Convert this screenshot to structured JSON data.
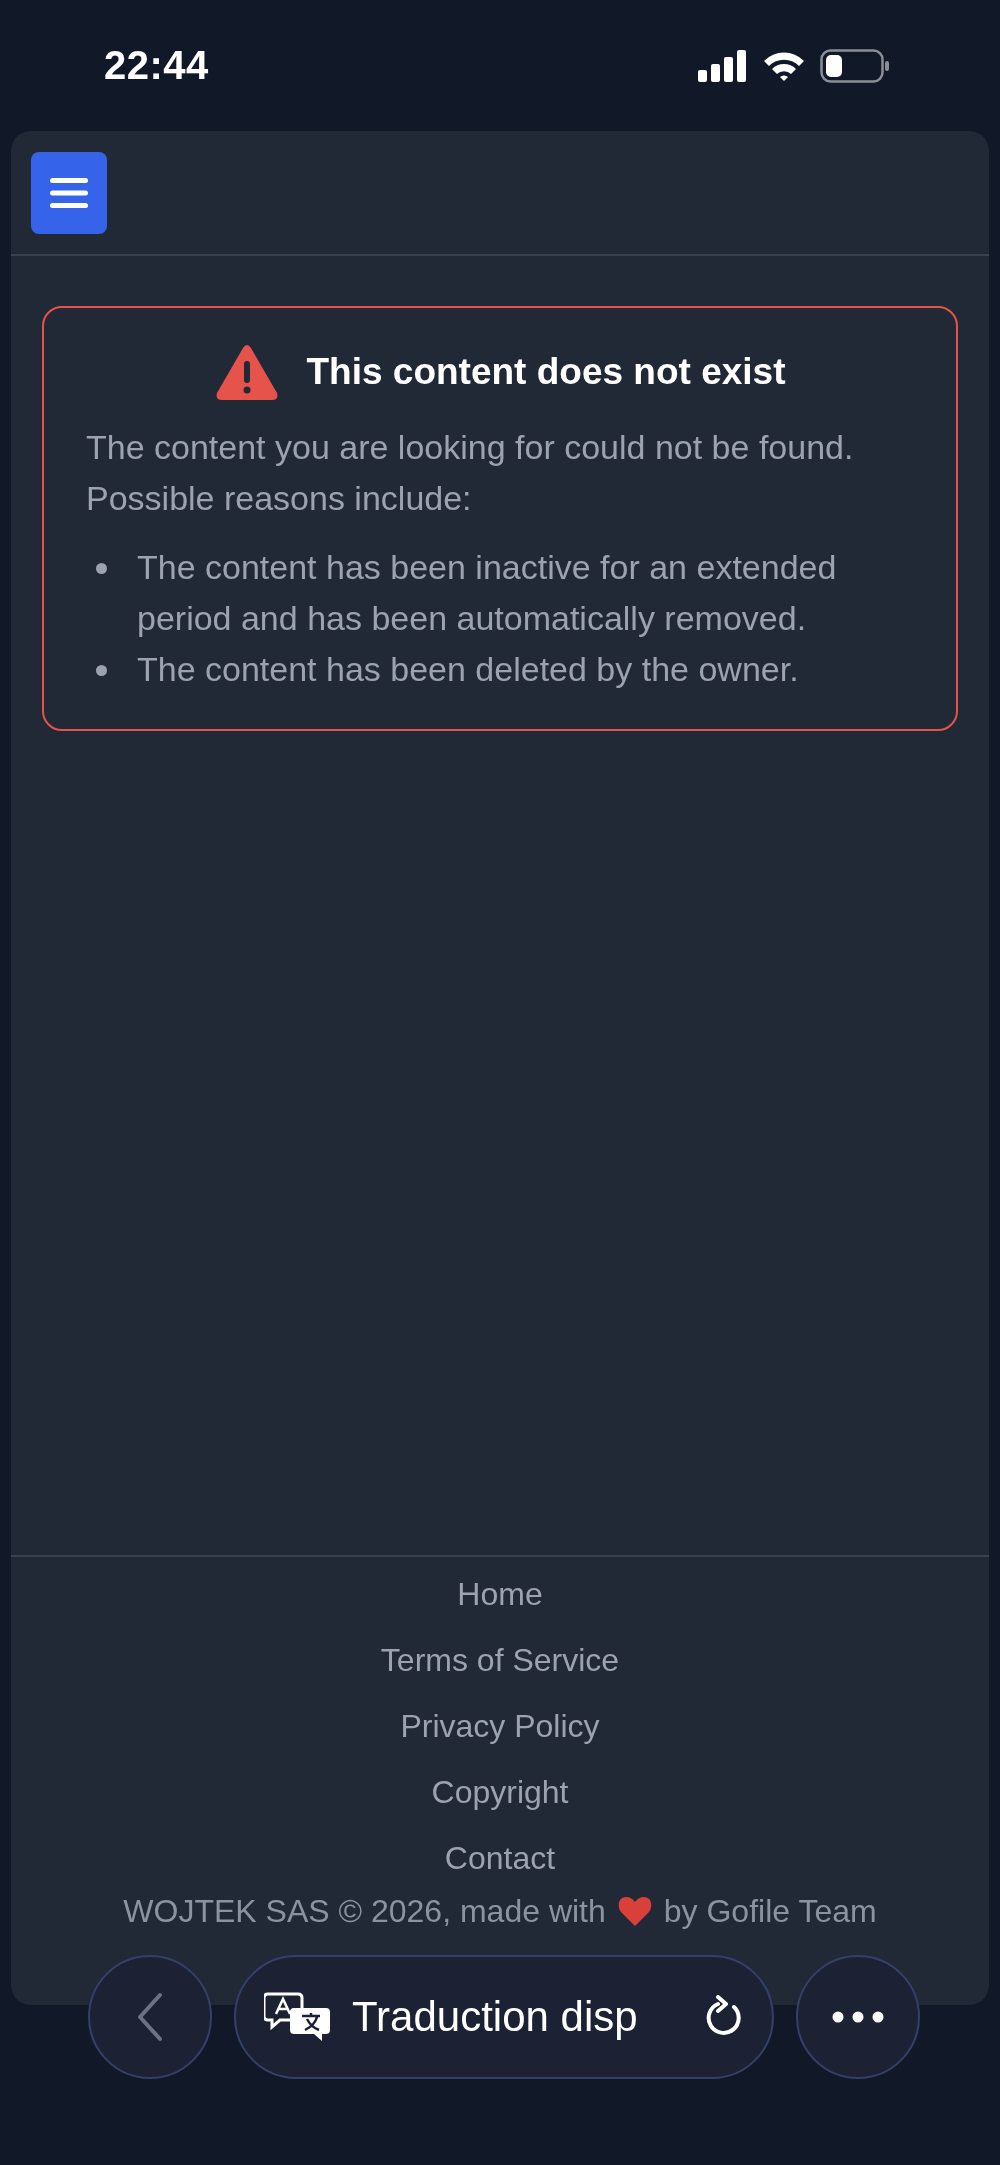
{
  "status_bar": {
    "time": "22:44"
  },
  "error": {
    "title": "This content does not exist",
    "message": "The content you are looking for could not be found. Possible reasons include:",
    "reasons": [
      "The content has been inactive for an extended period and has been automatically removed.",
      "The content has been deleted by the owner."
    ]
  },
  "footer": {
    "links": [
      "Home",
      "Terms of Service",
      "Privacy Policy",
      "Copyright",
      "Contact"
    ],
    "copyright_start": "WOJTEK SAS © 2026, made with",
    "copyright_end": "by Gofile Team"
  },
  "browser_bar": {
    "translation": "Traduction disp"
  }
}
